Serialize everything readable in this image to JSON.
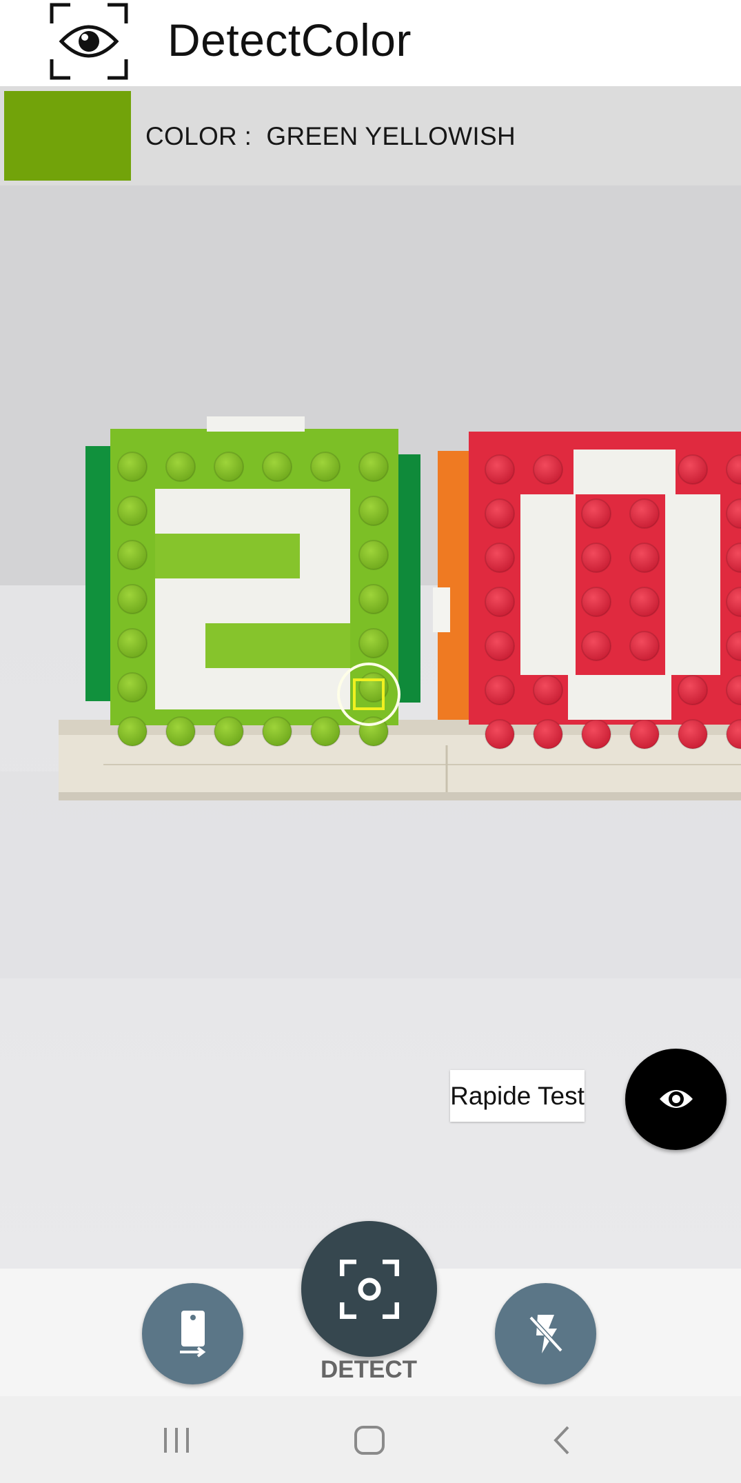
{
  "app": {
    "title": "DetectColor",
    "logo_icon": "eye-scan-icon"
  },
  "color_bar": {
    "label": "COLOR :  GREEN YELLOWISH",
    "swatch_color": "#72a30a"
  },
  "preview": {
    "rapid_test_label": "Rapide Test",
    "rapid_test_icon": "eye-icon",
    "target_icon": "color-target-icon"
  },
  "bottom_bar": {
    "switch_camera_icon": "switch-camera-icon",
    "detect_icon": "scan-icon",
    "detect_label": "DETECT",
    "flash_icon": "flash-off-icon"
  },
  "system_nav": {
    "recents_icon": "recents-icon",
    "home_icon": "home-icon",
    "back_icon": "back-icon"
  },
  "colors": {
    "detect_button": "#36474f",
    "small_buttons": "#5b7687",
    "eye_button": "#000000"
  }
}
